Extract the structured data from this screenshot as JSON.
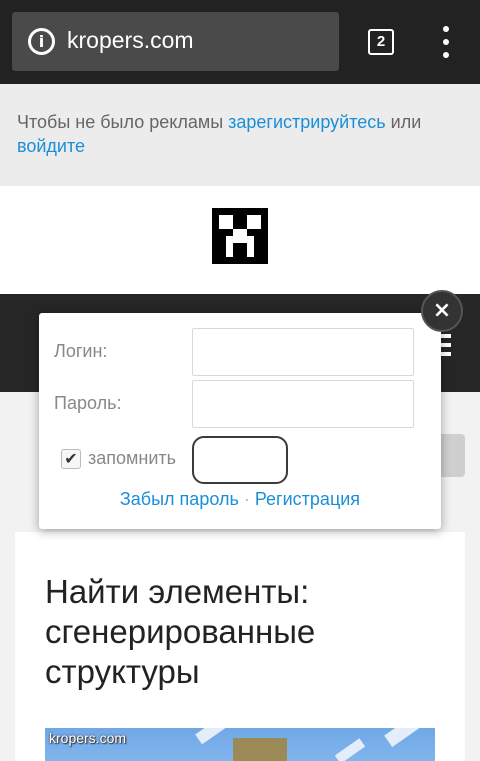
{
  "browser": {
    "url": "kropers.com",
    "tab_count": "2",
    "info_icon": "i"
  },
  "notice": {
    "text_before": "Чтобы не было рекламы ",
    "register_link": "зарегистрируйтесь",
    "text_middle": " или ",
    "login_link": "войдите"
  },
  "login_popup": {
    "login_label": "Логин:",
    "login_value": "",
    "password_label": "Пароль:",
    "password_value": "",
    "remember_label": "запомнить",
    "remember_checked": true,
    "submit_label": "",
    "forgot_link": "Забыл пароль",
    "separator": " · ",
    "register_link": "Регистрация",
    "close_label": "×"
  },
  "article": {
    "title": "Найти элементы: сгенерированные структуры",
    "image_watermark": "kropers.com"
  },
  "colors": {
    "link": "#1a8fd8",
    "chrome_bg": "#222222",
    "nav_bg": "#262626"
  }
}
